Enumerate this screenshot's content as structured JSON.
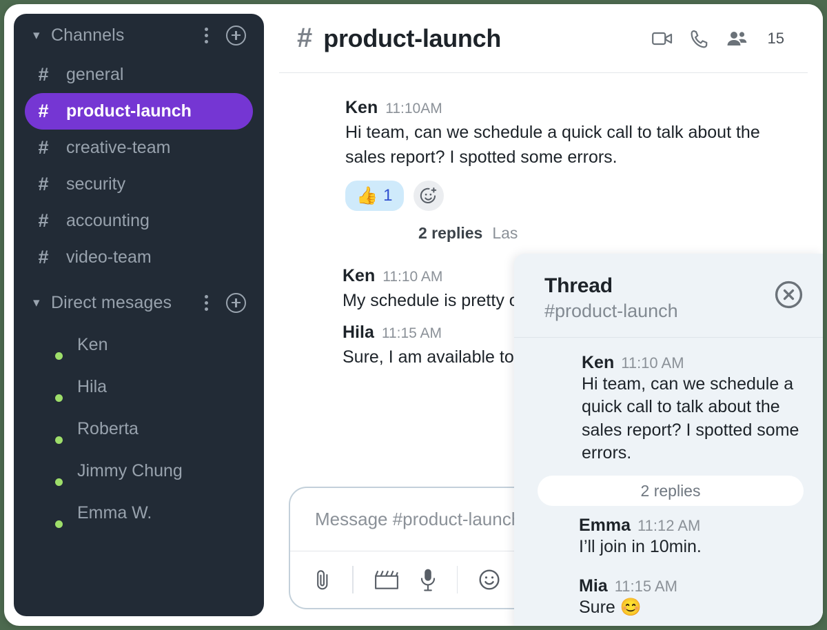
{
  "theme": {
    "page_bg": "#4d6a4f",
    "sidebar_bg": "#222b36",
    "accent_purple": "#7536d3",
    "thread_bg": "#eef3f7",
    "reaction_pill_bg": "#cfeafb",
    "status_online": "#9ede6a"
  },
  "sidebar": {
    "channels_section": {
      "label": "Channels",
      "chevron_icon": "chevron-down-icon",
      "menu_icon": "more-vertical-icon",
      "add_icon": "plus-circle-icon"
    },
    "channels": [
      {
        "hash": "#",
        "name": "general",
        "active": false
      },
      {
        "hash": "#",
        "name": "product-launch",
        "active": true
      },
      {
        "hash": "#",
        "name": "creative-team",
        "active": false
      },
      {
        "hash": "#",
        "name": "security",
        "active": false
      },
      {
        "hash": "#",
        "name": "accounting",
        "active": false
      },
      {
        "hash": "#",
        "name": "video-team",
        "active": false
      }
    ],
    "dm_section": {
      "label": "Direct mesages",
      "chevron_icon": "chevron-down-icon",
      "menu_icon": "more-vertical-icon",
      "add_icon": "plus-circle-icon"
    },
    "direct_messages": [
      {
        "name": "Ken",
        "status": "online"
      },
      {
        "name": "Hila",
        "status": "online"
      },
      {
        "name": "Roberta",
        "status": "online"
      },
      {
        "name": "Jimmy Chung",
        "status": "online"
      },
      {
        "name": "Emma W.",
        "status": "online"
      }
    ]
  },
  "header": {
    "hash": "#",
    "channel": "product-launch",
    "video_icon": "video-camera-icon",
    "call_icon": "phone-icon",
    "members_icon": "people-icon",
    "member_count": "15"
  },
  "messages": [
    {
      "author": "Ken",
      "time": "11:10AM",
      "text": "Hi team, can we schedule a quick call to talk about the sales report? I spotted some errors.",
      "reaction": {
        "emoji": "👍",
        "count": "1"
      },
      "add_reaction_icon": "add-reaction-icon",
      "thread": {
        "count_label": "2 replies",
        "last_label": "Las"
      }
    },
    {
      "author": "Ken",
      "time": "11:10 AM",
      "text": "My schedule is pretty op"
    },
    {
      "author": "Hila",
      "time": "11:15 AM",
      "text": "Sure, I am available tod"
    }
  ],
  "composer": {
    "placeholder": "Message #product-launch",
    "tools": [
      {
        "icon": "paperclip-icon",
        "name": "attach-file"
      },
      {
        "icon": "clapperboard-icon",
        "name": "video-clip"
      },
      {
        "icon": "microphone-icon",
        "name": "voice-record"
      },
      {
        "icon": "smiley-icon",
        "name": "emoji-picker"
      },
      {
        "icon": "circle-icon",
        "name": "more-tool"
      }
    ]
  },
  "thread": {
    "title": "Thread",
    "channel": "#product-launch",
    "close_icon": "close-circle-icon",
    "root": {
      "author": "Ken",
      "time": "11:10 AM",
      "text": "Hi team, can we schedule a quick call to talk about the sales report? I spotted some errors."
    },
    "divider_label": "2 replies",
    "replies": [
      {
        "author": "Emma",
        "time": "11:12 AM",
        "text": "I’ll join in 10min."
      },
      {
        "author": "Mia",
        "time": "11:15 AM",
        "text": "Sure 😊"
      }
    ]
  }
}
